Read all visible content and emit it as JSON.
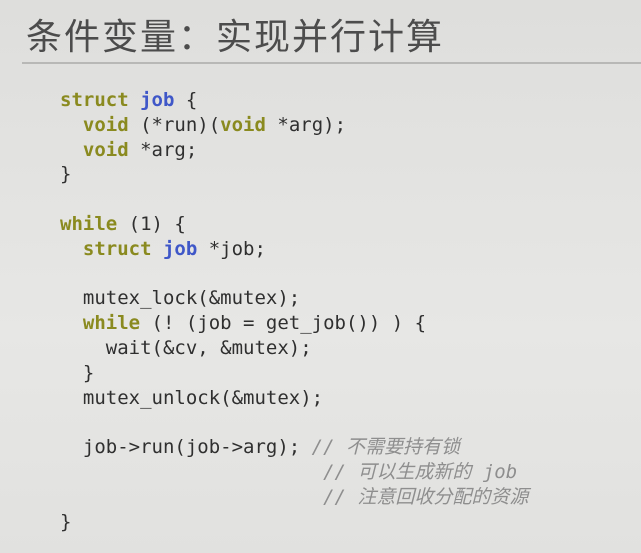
{
  "title": "条件变量：实现并行计算",
  "code": {
    "lines": [
      [
        {
          "t": "struct ",
          "c": "kw"
        },
        {
          "t": "job",
          "c": "ty"
        },
        {
          "t": " {",
          "c": "tx"
        }
      ],
      [
        {
          "t": "  ",
          "c": "tx"
        },
        {
          "t": "void",
          "c": "kw"
        },
        {
          "t": " (*run)(",
          "c": "tx"
        },
        {
          "t": "void",
          "c": "kw"
        },
        {
          "t": " *arg);",
          "c": "tx"
        }
      ],
      [
        {
          "t": "  ",
          "c": "tx"
        },
        {
          "t": "void",
          "c": "kw"
        },
        {
          "t": " *arg;",
          "c": "tx"
        }
      ],
      [
        {
          "t": "}",
          "c": "tx"
        }
      ],
      [],
      [
        {
          "t": "while",
          "c": "kw"
        },
        {
          "t": " (1) {",
          "c": "tx"
        }
      ],
      [
        {
          "t": "  ",
          "c": "tx"
        },
        {
          "t": "struct ",
          "c": "kw"
        },
        {
          "t": "job",
          "c": "ty"
        },
        {
          "t": " *job;",
          "c": "tx"
        }
      ],
      [],
      [
        {
          "t": "  mutex_lock(&mutex);",
          "c": "tx"
        }
      ],
      [
        {
          "t": "  ",
          "c": "tx"
        },
        {
          "t": "while",
          "c": "kw"
        },
        {
          "t": " (! (job = get_job()) ) {",
          "c": "tx"
        }
      ],
      [
        {
          "t": "    wait(&cv, &mutex);",
          "c": "tx"
        }
      ],
      [
        {
          "t": "  }",
          "c": "tx"
        }
      ],
      [
        {
          "t": "  mutex_unlock(&mutex);",
          "c": "tx"
        }
      ],
      [],
      [
        {
          "t": "  job->run(job->arg); ",
          "c": "tx"
        },
        {
          "t": "// 不需要持有锁",
          "c": "cm"
        }
      ],
      [
        {
          "t": "                       ",
          "c": "tx"
        },
        {
          "t": "// 可以生成新的 job",
          "c": "cm"
        }
      ],
      [
        {
          "t": "                       ",
          "c": "tx"
        },
        {
          "t": "// 注意回收分配的资源",
          "c": "cm"
        }
      ],
      [
        {
          "t": "}",
          "c": "tx"
        }
      ]
    ]
  },
  "colors": {
    "background": "#e3e3e1",
    "title": "#4c4c4c",
    "keyword": "#8a8a1f",
    "type": "#3f57c8",
    "text": "#2f2f2f",
    "comment": "#8e8e8e"
  }
}
